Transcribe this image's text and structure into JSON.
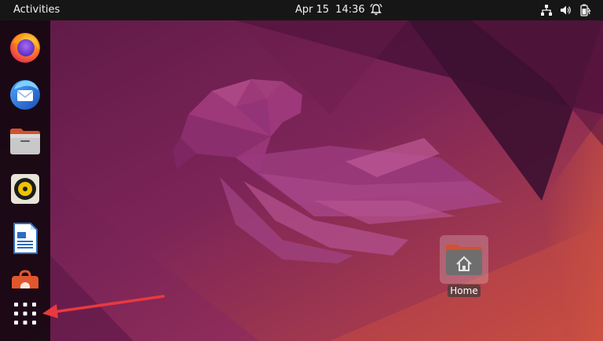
{
  "topbar": {
    "activities_label": "Activities",
    "date": "Apr 15",
    "time": "14:36",
    "bell_icon": "bell-icon",
    "network_icon": "network-wired-icon",
    "volume_icon": "volume-icon",
    "battery_icon": "battery-icon"
  },
  "dock": {
    "items": [
      {
        "name": "Firefox",
        "icon": "firefox-icon"
      },
      {
        "name": "Thunderbird",
        "icon": "thunderbird-icon"
      },
      {
        "name": "Files",
        "icon": "files-icon"
      },
      {
        "name": "Rhythmbox",
        "icon": "rhythmbox-icon"
      },
      {
        "name": "LibreOffice Writer",
        "icon": "writer-icon"
      },
      {
        "name": "Ubuntu Software",
        "icon": "software-icon"
      }
    ],
    "show_apps_icon": "grid-icon"
  },
  "desktop": {
    "home_label": "Home",
    "home_icon": "home-folder-icon"
  },
  "annotation": {
    "arrow_color": "#e8393e",
    "target": "show-apps-button"
  },
  "colors": {
    "topbar_bg": "#161616",
    "dock_bg": "#140810",
    "wallpaper_base": "#7a2556",
    "wallpaper_accent": "#c9473f"
  }
}
